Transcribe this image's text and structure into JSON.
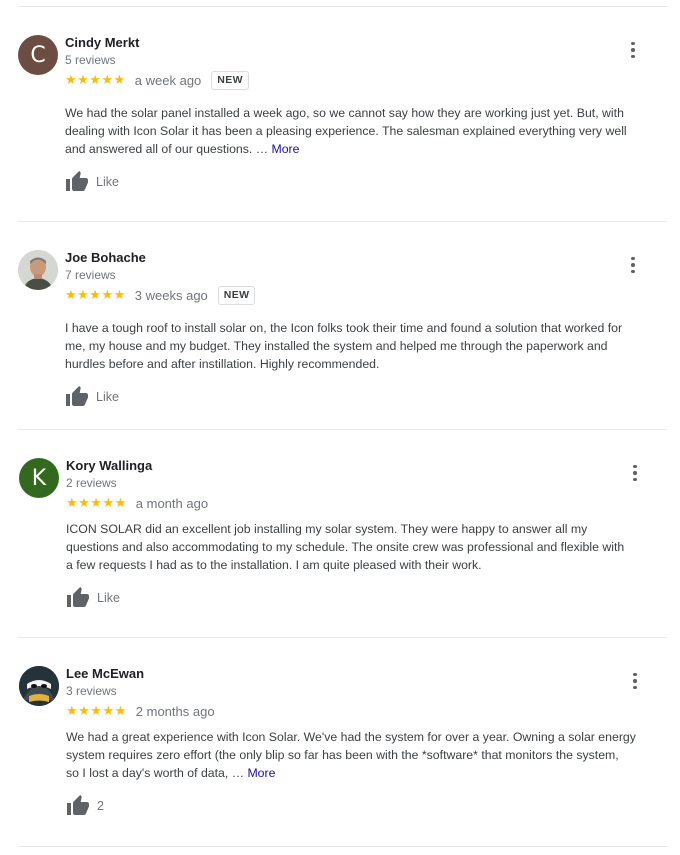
{
  "reviews": [
    {
      "name": "Cindy Merkt",
      "count": "5 reviews",
      "initial": "C",
      "avatar_color": "#6d4c41",
      "stars": "★★★★★",
      "rating": 5,
      "date": "a week ago",
      "badge": "NEW",
      "lines": [
        "We had the solar panel installed a week ago, so we cannot say how they are working just yet. But, with",
        "dealing with Icon Solar it has been a pleasing experience. The salesman explained everything very well",
        "and answered all of our questions. …"
      ],
      "more_label": "More",
      "like_label": "Like"
    },
    {
      "name": "Joe Bohache",
      "count": "7 reviews",
      "avatar_icon": "person-photo-icon",
      "stars": "★★★★★",
      "rating": 5,
      "date": "3 weeks ago",
      "badge": "NEW",
      "lines": [
        "I have a tough roof to install solar on, the Icon folks took their time and found a solution that worked for",
        "me, my house and my budget. They installed the system and helped me through the paperwork and",
        "hurdles before and after instillation. Highly recommended."
      ],
      "like_label": "Like"
    },
    {
      "name": "Kory Wallinga",
      "count": "2 reviews",
      "initial": "K",
      "avatar_color": "#33691e",
      "stars": "★★★★★",
      "rating": 5,
      "date": "a month ago",
      "lines": [
        "ICON SOLAR did an excellent job installing my solar system.  They were happy to answer all my",
        "questions and also accommodating to my schedule.  The onsite crew was professional and flexible with",
        "a few requests I had as to the installation.  I am quite pleased with their work."
      ],
      "like_label": "Like"
    },
    {
      "name": "Lee McEwan",
      "count": "3 reviews",
      "avatar_icon": "cartoon-ninja-avatar-icon",
      "stars": "★★★★★",
      "rating": 5,
      "date": "2 months ago",
      "lines": [
        "We had a great experience with Icon Solar. We've had the system for over a year. Owning a solar energy",
        "system requires zero effort (the only blip so far has been with the *software* that monitors the system,",
        "so I lost a day's worth of data, …"
      ],
      "more_label": "More",
      "like_label": "2"
    }
  ],
  "colors": {
    "star": "#fbbc04",
    "link": "#1a0dab",
    "muted": "#70757a"
  }
}
